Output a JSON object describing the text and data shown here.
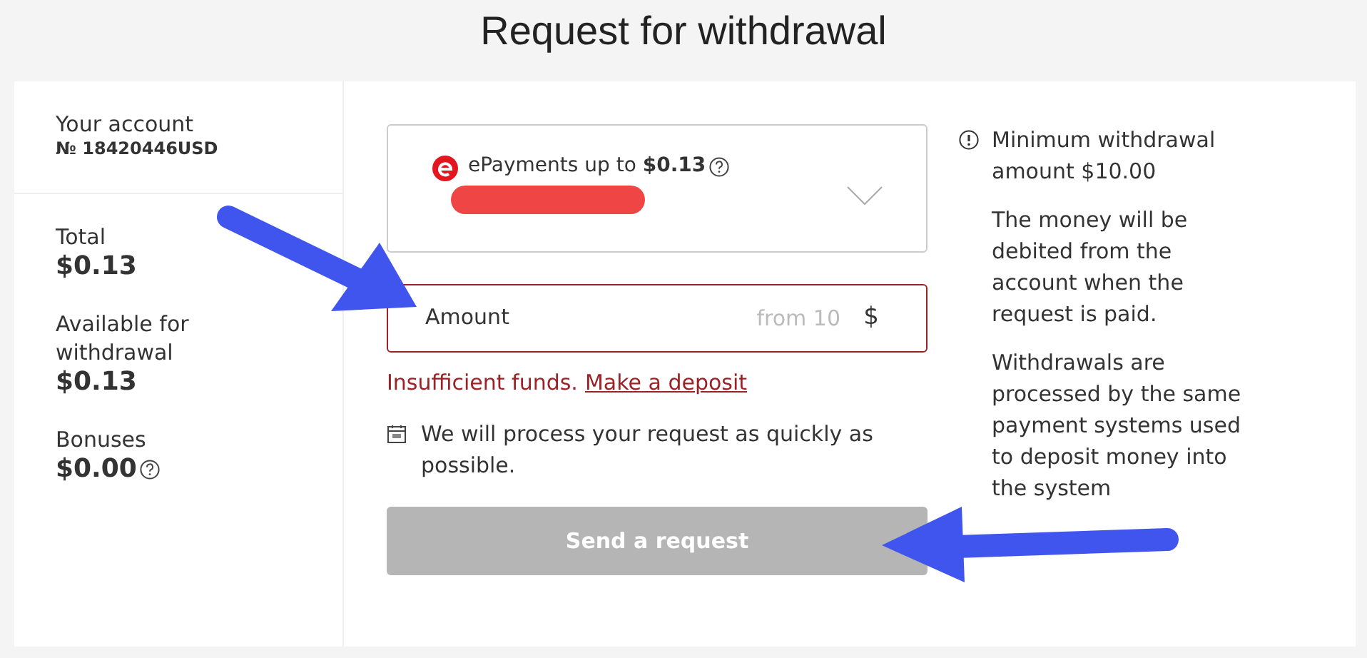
{
  "title": "Request for withdrawal",
  "account": {
    "label": "Your account",
    "number": "№ 18420446USD"
  },
  "balances": [
    {
      "label": "Total",
      "value": "$0.13",
      "help": false
    },
    {
      "label": "Available for withdrawal",
      "value": "$0.13",
      "help": false
    },
    {
      "label": "Bonuses",
      "value": "$0.00",
      "help": true
    }
  ],
  "method": {
    "text": "ePayments up to **$0.13**",
    "help": true,
    "expanded": false
  },
  "amount": {
    "label": "Amount",
    "placeholder": "from 10",
    "currency": "$",
    "error": true
  },
  "error_text": "Insufficient funds.",
  "deposit_link": "Make a deposit",
  "note": "We will process your request as quickly as possible.",
  "submit": {
    "label": "Send a request",
    "disabled": true
  },
  "info": [
    "Minimum withdrawal amount $10.00",
    "The money will be debited from the account when the request is paid.",
    "Withdrawals are processed by the same payment systems used to deposit money into the system"
  ]
}
